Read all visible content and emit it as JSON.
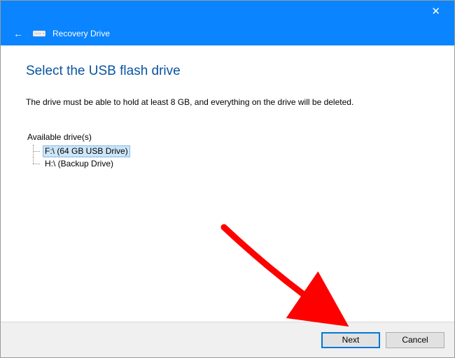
{
  "titlebar": {
    "close_glyph": "✕"
  },
  "header": {
    "back_arrow": "←",
    "wizard_title": "Recovery Drive"
  },
  "page": {
    "heading": "Select the USB flash drive",
    "description": "The drive must be able to hold at least 8 GB, and everything on the drive will be deleted."
  },
  "drives": {
    "label": "Available drive(s)",
    "items": [
      {
        "text": "F:\\ (64 GB USB Drive)",
        "selected": true
      },
      {
        "text": "H:\\ (Backup Drive)",
        "selected": false
      }
    ]
  },
  "buttons": {
    "next": "Next",
    "cancel": "Cancel"
  },
  "colors": {
    "accent": "#0a84ff",
    "heading": "#0a53a2",
    "selection": "#cde6f9",
    "annotation_arrow": "#ff0000"
  }
}
